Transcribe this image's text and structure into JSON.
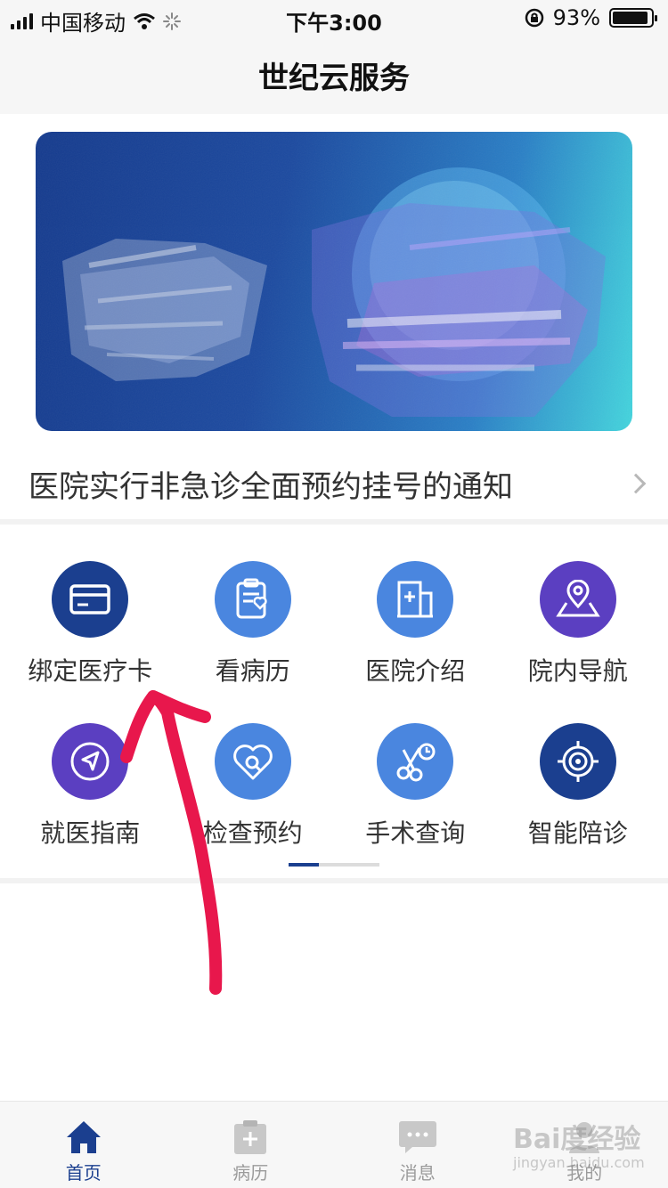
{
  "status_bar": {
    "carrier": "中国移动",
    "time": "下午3:00",
    "battery_percent_text": "93%",
    "battery_level": 0.93
  },
  "nav": {
    "title": "世纪云服务"
  },
  "notice": {
    "text": "医院实行非急诊全面预约挂号的通知"
  },
  "services": [
    {
      "label": "绑定医疗卡",
      "icon": "card-icon",
      "color": "#1b3f8f"
    },
    {
      "label": "看病历",
      "icon": "medical-record-icon",
      "color": "#4a86df"
    },
    {
      "label": "医院介绍",
      "icon": "hospital-building-icon",
      "color": "#4a86df"
    },
    {
      "label": "院内导航",
      "icon": "map-pin-icon",
      "color": "#5b3fc1"
    },
    {
      "label": "就医指南",
      "icon": "compass-arrow-icon",
      "color": "#5b3fc1"
    },
    {
      "label": "检查预约",
      "icon": "heart-search-icon",
      "color": "#4a86df"
    },
    {
      "label": "手术查询",
      "icon": "surgery-scissors-icon",
      "color": "#4a86df"
    },
    {
      "label": "智能陪诊",
      "icon": "target-icon",
      "color": "#1b3f8f"
    }
  ],
  "pager": {
    "active_index": 0,
    "page_count": 2
  },
  "tabs": [
    {
      "label": "首页",
      "icon": "home-icon",
      "active": true
    },
    {
      "label": "病历",
      "icon": "clipboard-icon",
      "active": false
    },
    {
      "label": "消息",
      "icon": "message-icon",
      "active": false
    },
    {
      "label": "我的",
      "icon": "user-icon",
      "active": false
    }
  ],
  "watermark": {
    "text": "Bai度经验",
    "sub": "jingyan.baidu.com"
  },
  "colors": {
    "accent": "#1b3f8f",
    "annotation": "#e8174c"
  }
}
